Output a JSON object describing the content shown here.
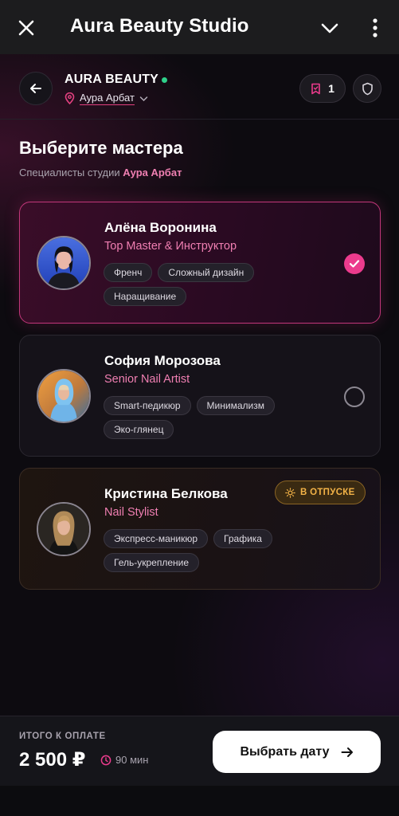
{
  "appbar": {
    "title": "Aura Beauty Studio"
  },
  "shop": {
    "brand": "AURA BEAUTY",
    "location": "Аура Арбат",
    "saved_count": "1"
  },
  "page": {
    "heading": "Выберите мастера",
    "subtitle_prefix": "Специалисты студии ",
    "subtitle_studio": "Аура Арбат"
  },
  "masters": [
    {
      "name": "Алёна Воронина",
      "role": "Top Master & Инструктор",
      "tags": [
        "Френч",
        "Сложный дизайн",
        "Наращивание"
      ],
      "selected": true
    },
    {
      "name": "София Морозова",
      "role": "Senior Nail Artist",
      "tags": [
        "Smart-педикюр",
        "Минимализм",
        "Эко-глянец"
      ],
      "selected": false
    },
    {
      "name": "Кристина Белкова",
      "role": "Nail Stylist",
      "tags": [
        "Экспресс-маникюр",
        "Графика",
        "Гель-укрепление"
      ],
      "selected": false,
      "badge": "В ОТПУСКЕ"
    }
  ],
  "footer": {
    "total_label": "ИТОГО К ОПЛАТЕ",
    "price": "2 500 ₽",
    "duration": "90 мин",
    "cta": "Выбрать дату"
  },
  "colors": {
    "accent": "#ec3b8d",
    "accent_text": "#f07fb2",
    "online": "#2fd08a",
    "vacation": "#f2b247"
  }
}
